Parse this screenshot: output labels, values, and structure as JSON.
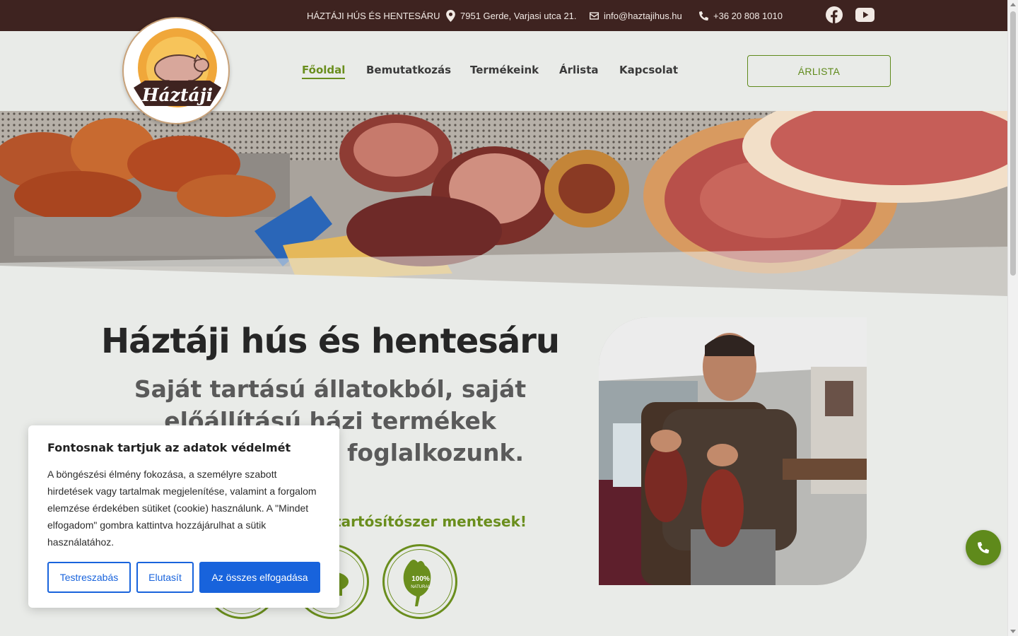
{
  "topbar": {
    "brand": "HÁZTÁJI HÚS ÉS HENTESÁRU",
    "address": "7951 Gerde, Varjasi utca 21.",
    "email": "info@haztajihus.hu",
    "phone": "+36 20 808 1010"
  },
  "logo": {
    "text": "Háztáji"
  },
  "nav": {
    "items": [
      "Főoldal",
      "Bemutatkozás",
      "Termékeink",
      "Árlista",
      "Kapcsolat"
    ],
    "cta": "ÁRLISTA"
  },
  "main": {
    "title": "Háztáji hús és hentesáru",
    "subtitle": "Saját tartású állatokból, saját előállítású házi termékek értékesítésével foglalkozunk.",
    "green_line": "tartósítószer mentesek!",
    "badge_text": "100% NATURAL"
  },
  "cookie": {
    "title": "Fontosnak tartjuk az adatok védelmét",
    "body": "A böngészési élmény fokozása, a személyre szabott hirdetések vagy tartalmak megjelenítése, valamint a forgalom elemzése érdekében sütiket (cookie) használunk. A \"Mindet elfogadom\" gombra kattintva hozzájárulhat a sütik használatához.",
    "customize": "Testreszabás",
    "reject": "Elutasít",
    "accept_all": "Az összes elfogadása"
  },
  "colors": {
    "brown": "#3e2320",
    "green": "#6a8e1d",
    "blue": "#1863dc",
    "bg": "#e9ebe8"
  }
}
